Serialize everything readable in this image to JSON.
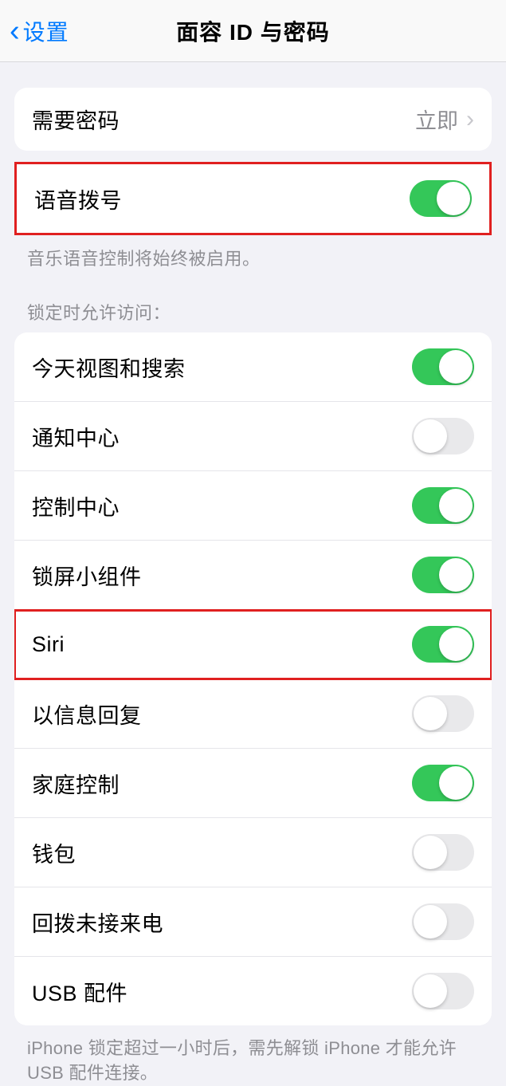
{
  "nav": {
    "back_label": "设置",
    "title": "面容 ID 与密码"
  },
  "require_passcode": {
    "label": "需要密码",
    "value": "立即"
  },
  "voice_dial": {
    "label": "语音拨号",
    "enabled": true,
    "footer": "音乐语音控制将始终被启用。"
  },
  "allow_access_header": "锁定时允许访问：",
  "allow_access_items": [
    {
      "label": "今天视图和搜索",
      "enabled": true
    },
    {
      "label": "通知中心",
      "enabled": false
    },
    {
      "label": "控制中心",
      "enabled": true
    },
    {
      "label": "锁屏小组件",
      "enabled": true
    },
    {
      "label": "Siri",
      "enabled": true
    },
    {
      "label": "以信息回复",
      "enabled": false
    },
    {
      "label": "家庭控制",
      "enabled": true
    },
    {
      "label": "钱包",
      "enabled": false
    },
    {
      "label": "回拨未接来电",
      "enabled": false
    },
    {
      "label": "USB 配件",
      "enabled": false
    }
  ],
  "usb_footer": "iPhone 锁定超过一小时后，需先解锁 iPhone 才能允许 USB 配件连接。"
}
